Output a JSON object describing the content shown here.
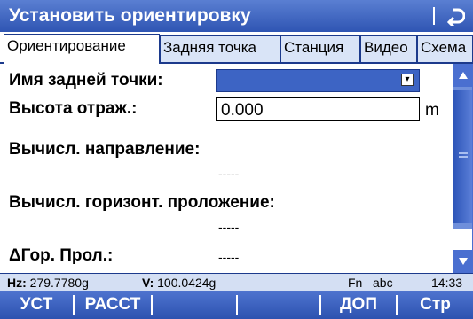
{
  "window": {
    "title": "Установить ориентировку"
  },
  "tabs": [
    {
      "label": "Ориентирование",
      "active": true
    },
    {
      "label": "Задняя точка",
      "active": false
    },
    {
      "label": "Станция",
      "active": false
    },
    {
      "label": "Видео",
      "active": false
    },
    {
      "label": "Схема",
      "active": false
    }
  ],
  "form": {
    "backsight_label": "Имя задней точки:",
    "backsight_value": "",
    "reflector_height_label": "Высота отраж.:",
    "reflector_height_value": "0.000",
    "reflector_height_unit": "m",
    "calc_direction_label": "Вычисл. направление:",
    "calc_direction_value": "-----",
    "calc_hdist_label": "Вычисл. горизонт. проложение:",
    "calc_hdist_value": "-----",
    "delta_hdist_label": "ΔГор. Прол.:",
    "delta_hdist_value": "-----"
  },
  "status": {
    "hz_label": "Hz:",
    "hz_value": "279.7780g",
    "v_label": "V:",
    "v_value": "100.0424g",
    "fn_label": "Fn",
    "input_mode": "abc",
    "time": "14:33"
  },
  "softkeys": {
    "f1": "УСТ",
    "f2": "РАССТ",
    "f3": "",
    "f4": "",
    "f5": "ДОП",
    "f6": "Стр"
  },
  "colors": {
    "title_bar": "#3d64c4",
    "accent": "#1c3a8c",
    "tab_inactive": "#d9e4f7",
    "status_bar": "#d4dff3"
  }
}
